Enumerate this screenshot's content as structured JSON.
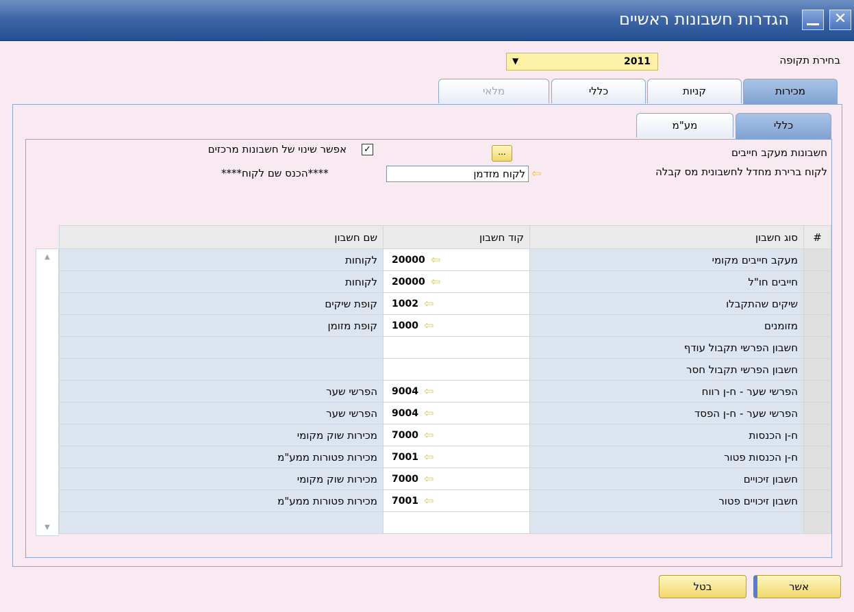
{
  "window": {
    "title": "הגדרות חשבונות ראשיים",
    "close_glyph": "✕"
  },
  "period": {
    "label": "בחירת תקופה",
    "selected": "2011",
    "arrow": "▼"
  },
  "main_tabs": [
    "מכירות",
    "קניות",
    "כללי",
    "מלאי"
  ],
  "sub_tabs": [
    "כללי",
    "מע\"מ"
  ],
  "general": {
    "ar_accounts_label": "חשבונות מעקב חייבים",
    "dots_label": "...",
    "allow_change_label": "אפשר שינוי של חשבונות מרכזים",
    "allow_change_checked": "✓",
    "default_customer_label": "לקוח ברירת מחדל לחשבונית מס קבלה",
    "default_customer_value": "לקוח מזדמן",
    "customer_name_hint": "****הכנס שם לקוח****",
    "arrow_glyph": "⇦"
  },
  "grid": {
    "columns": [
      "#",
      "סוג חשבון",
      "קוד חשבון",
      "שם חשבון"
    ],
    "scroll_up": "▲",
    "scroll_down": "▼",
    "rows": [
      {
        "type": "מעקב חייבים מקומי",
        "code": "20000",
        "name": "לקוחות"
      },
      {
        "type": "חייבים חו\"ל",
        "code": "20000",
        "name": "לקוחות"
      },
      {
        "type": "שיקים שהתקבלו",
        "code": "1002",
        "name": "קופת שיקים"
      },
      {
        "type": "מזומנים",
        "code": "1000",
        "name": "קופת מזומן"
      },
      {
        "type": "חשבון הפרשי תקבול עודף",
        "code": "",
        "name": ""
      },
      {
        "type": "חשבון הפרשי תקבול חסר",
        "code": "",
        "name": ""
      },
      {
        "type": "הפרשי שער -  ח-ן רווח",
        "code": "9004",
        "name": "הפרשי שער"
      },
      {
        "type": "הפרשי שער - ח-ן הפסד",
        "code": "9004",
        "name": "הפרשי שער"
      },
      {
        "type": "ח-ן הכנסות",
        "code": "7000",
        "name": "מכירות שוק מקומי"
      },
      {
        "type": "ח-ן הכנסות פטור",
        "code": "7001",
        "name": "מכירות פטורות ממע\"מ"
      },
      {
        "type": "חשבון זיכויים",
        "code": "7000",
        "name": "מכירות שוק מקומי"
      },
      {
        "type": "חשבון זיכויים פטור",
        "code": "7001",
        "name": "מכירות פטורות ממע\"מ"
      },
      {
        "type": "",
        "code": "",
        "name": ""
      }
    ]
  },
  "buttons": {
    "ok": "אשר",
    "cancel": "בטל"
  }
}
